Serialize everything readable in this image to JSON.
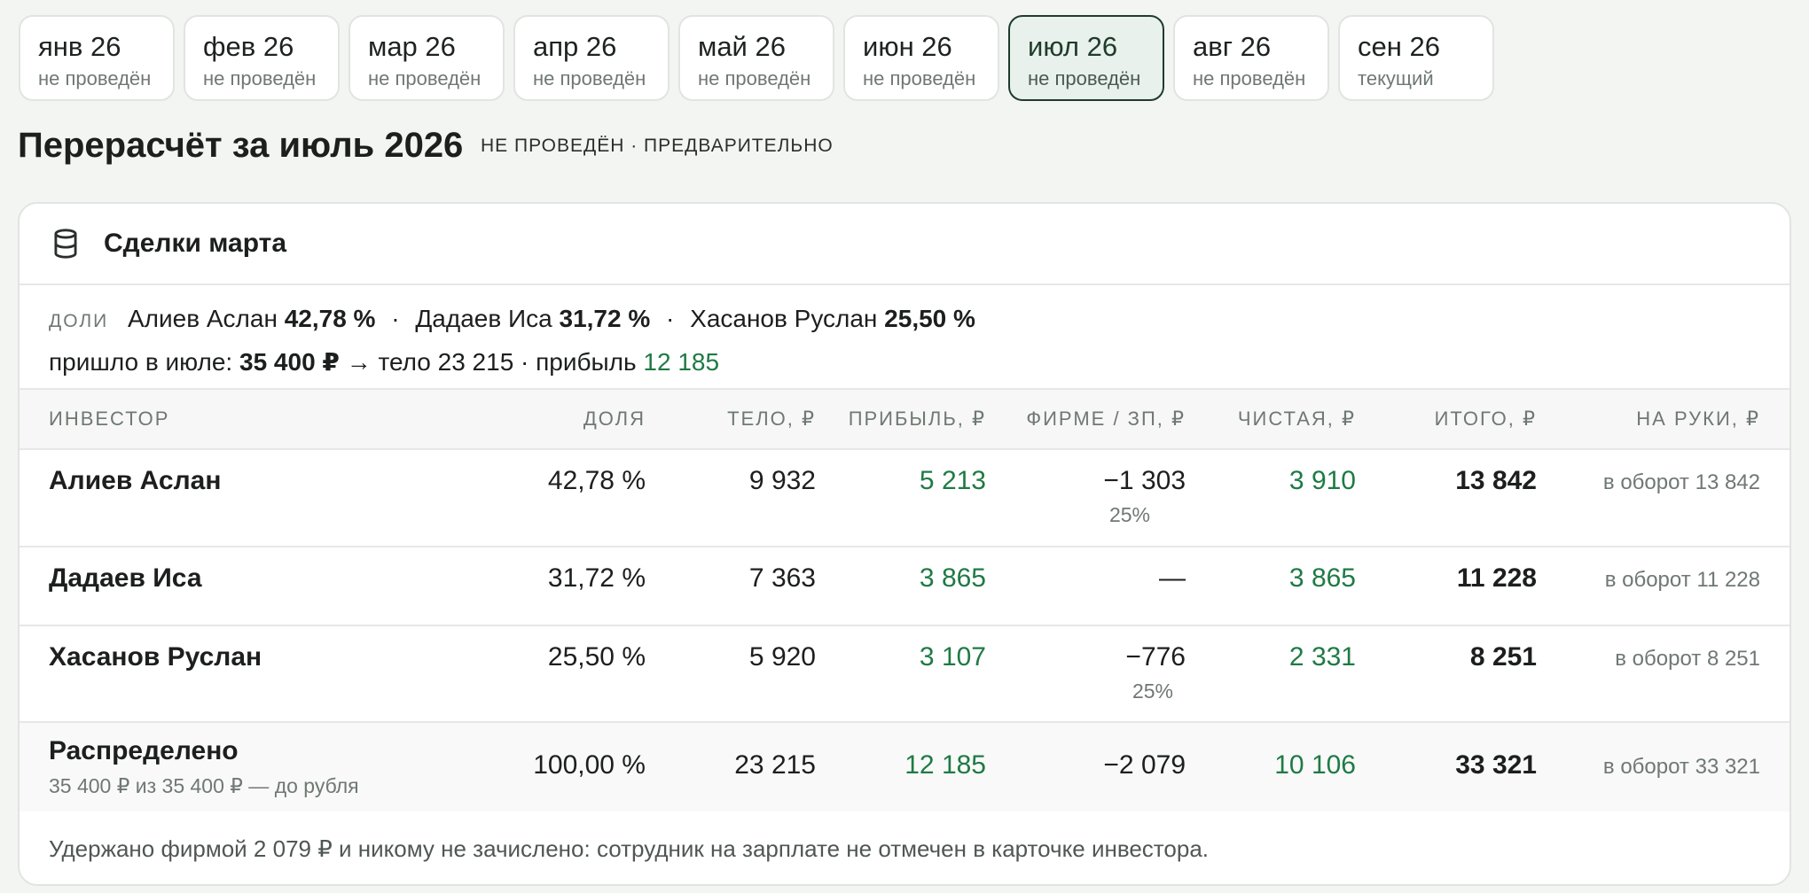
{
  "tabs": [
    {
      "title": "янв 26",
      "status": "не проведён"
    },
    {
      "title": "фев 26",
      "status": "не проведён"
    },
    {
      "title": "мар 26",
      "status": "не проведён"
    },
    {
      "title": "апр 26",
      "status": "не проведён"
    },
    {
      "title": "май 26",
      "status": "не проведён"
    },
    {
      "title": "июн 26",
      "status": "не проведён"
    },
    {
      "title": "июл 26",
      "status": "не проведён",
      "active": true
    },
    {
      "title": "авг 26",
      "status": "не проведён"
    },
    {
      "title": "сен 26",
      "status": "текущий"
    }
  ],
  "page": {
    "title": "Перерасчёт за июль 2026",
    "status": "НЕ ПРОВЕДЁН · ПРЕДВАРИТЕЛЬНО"
  },
  "card": {
    "icon": "database-icon",
    "title": "Сделки марта",
    "shares_label": "ДОЛИ",
    "shares": [
      {
        "name": "Алиев Аслан",
        "pct": "42,78 %"
      },
      {
        "name": "Дадаев Иса",
        "pct": "31,72 %"
      },
      {
        "name": "Хасанов Руслан",
        "pct": "25,50 %"
      }
    ],
    "separator": "·",
    "income_prefix": "пришло в июле:",
    "income_amount": "35 400 ₽",
    "income_rest": "→ тело 23 215 · прибыль",
    "income_profit": "12 185"
  },
  "table": {
    "headers": {
      "investor": "ИНВЕСТОР",
      "share": "ДОЛЯ",
      "body": "ТЕЛО, ₽",
      "profit": "ПРИБЫЛЬ, ₽",
      "firm": "ФИРМЕ / ЗП, ₽",
      "net": "ЧИСТАЯ, ₽",
      "total": "ИТОГО, ₽",
      "hand": "НА РУКИ, ₽"
    },
    "rows": [
      {
        "name": "Алиев Аслан",
        "share": "42,78 %",
        "body": "9 932",
        "profit": "5 213",
        "firm": "−1 303",
        "firm_sub": "25%",
        "net": "3 910",
        "total": "13 842",
        "hand": "в оборот 13 842"
      },
      {
        "name": "Дадаев Иса",
        "share": "31,72 %",
        "body": "7 363",
        "profit": "3 865",
        "firm": "—",
        "firm_sub": "",
        "net": "3 865",
        "total": "11 228",
        "hand": "в оборот 11 228"
      },
      {
        "name": "Хасанов Руслан",
        "share": "25,50 %",
        "body": "5 920",
        "profit": "3 107",
        "firm": "−776",
        "firm_sub": "25%",
        "net": "2 331",
        "total": "8 251",
        "hand": "в оборот 8 251"
      }
    ],
    "total": {
      "name": "Распределено",
      "sub": "35 400 ₽ из 35 400 ₽ — до рубля",
      "share": "100,00 %",
      "body": "23 215",
      "profit": "12 185",
      "firm": "−2 079",
      "net": "10 106",
      "total": "33 321",
      "hand": "в оборот 33 321"
    }
  },
  "footer_note": "Удержано фирмой 2 079 ₽ и никому не зачислено: сотрудник на зарплате не отмечен в карточке инвестора.",
  "colors": {
    "accent_green": "#1f7a45",
    "active_tab_border": "#1f3b2c",
    "active_tab_bg": "#e8f1eb"
  }
}
